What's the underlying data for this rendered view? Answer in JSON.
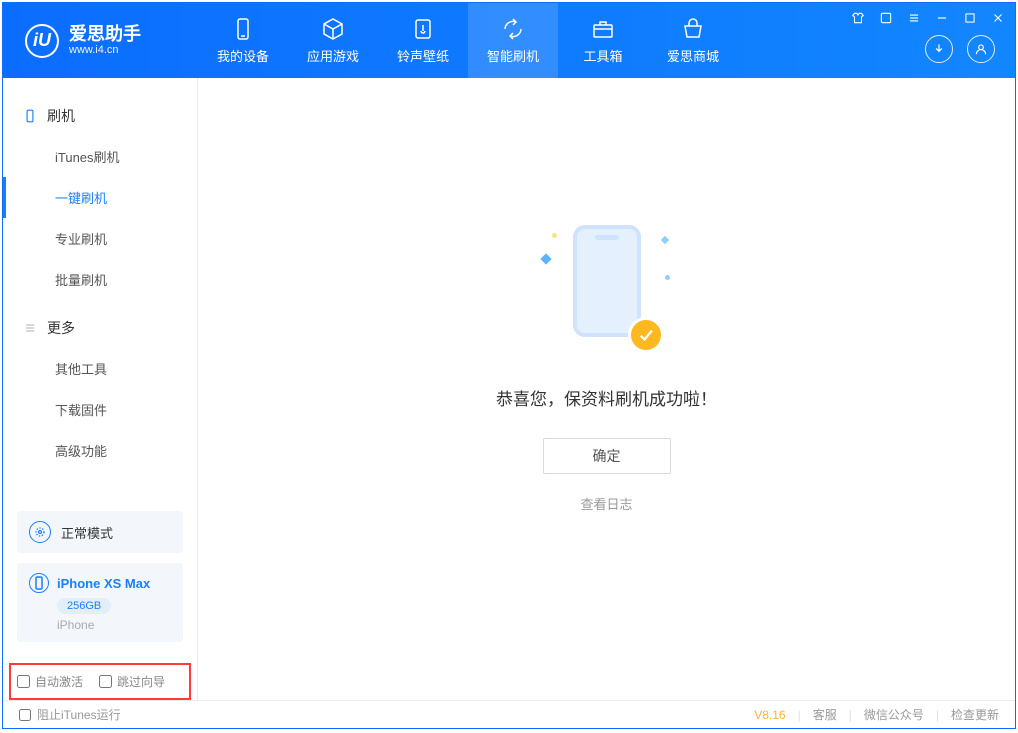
{
  "app": {
    "title": "爱思助手",
    "subtitle": "www.i4.cn",
    "logo_letter": "iU"
  },
  "nav": {
    "my_device": "我的设备",
    "apps_games": "应用游戏",
    "ringtones": "铃声壁纸",
    "smart_flash": "智能刷机",
    "toolbox": "工具箱",
    "store": "爱思商城"
  },
  "sidebar": {
    "flash_header": "刷机",
    "items_flash": [
      "iTunes刷机",
      "一键刷机",
      "专业刷机",
      "批量刷机"
    ],
    "more_header": "更多",
    "items_more": [
      "其他工具",
      "下载固件",
      "高级功能"
    ]
  },
  "device_status": {
    "mode": "正常模式",
    "name": "iPhone XS Max",
    "capacity": "256GB",
    "type": "iPhone"
  },
  "options": {
    "auto_activate": "自动激活",
    "skip_guide": "跳过向导"
  },
  "main": {
    "success_msg": "恭喜您，保资料刷机成功啦！",
    "ok": "确定",
    "view_log": "查看日志"
  },
  "status": {
    "block_itunes": "阻止iTunes运行",
    "version": "V8.16",
    "support": "客服",
    "wechat": "微信公众号",
    "check_update": "检查更新"
  }
}
